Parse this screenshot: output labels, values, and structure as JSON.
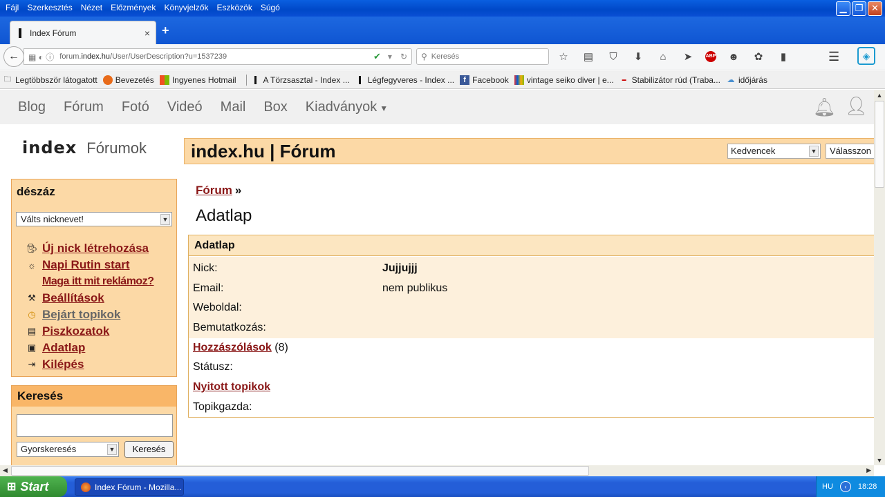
{
  "menubar": [
    "Fájl",
    "Szerkesztés",
    "Nézet",
    "Előzmények",
    "Könyvjelzők",
    "Eszközök",
    "Súgó"
  ],
  "tab": {
    "title": "Index Fórum",
    "close": "×",
    "new": "+"
  },
  "nav": {
    "url_prefix": "forum.",
    "url_domain": "index.hu",
    "url_path": "/User/UserDescription?u=1537239",
    "search_placeholder": "Keresés"
  },
  "bookmarks": [
    "Legtöbbször látogatott",
    "Bevezetés",
    "Ingyenes Hotmail",
    "A Törzsasztal - Index ...",
    "Légfegyveres - Index ...",
    "Facebook",
    "vintage seiko diver | e...",
    "Stabilizátor rúd (Traba...",
    "időjárás"
  ],
  "topnav": [
    "Blog",
    "Fórum",
    "Fotó",
    "Videó",
    "Mail",
    "Box",
    "Kiadványok"
  ],
  "logo": {
    "brand": "index",
    "section": "Fórumok"
  },
  "header": {
    "title": "index.hu | Fórum",
    "favorites": "Kedvencek",
    "choose": "Válasszon"
  },
  "sidebar": {
    "nick": "dészáz",
    "nick_select": "Válts nicknevet!",
    "links": [
      {
        "label": "Új nick létrehozása",
        "icon": "agent-icon"
      },
      {
        "label": "Napi Rutin start",
        "icon": "sun-icon"
      },
      {
        "label": "Maga itt mit reklámoz?",
        "icon": ""
      },
      {
        "label": "Beállítások",
        "icon": "tools-icon"
      },
      {
        "label": "Bejárt topikok",
        "icon": "clock-icon"
      },
      {
        "label": "Piszkozatok",
        "icon": "notepad-icon"
      },
      {
        "label": "Adatlap",
        "icon": "document-icon"
      },
      {
        "label": "Kilépés",
        "icon": "logout-icon"
      }
    ],
    "search": {
      "title": "Keresés",
      "mode": "Gyorskeresés",
      "button": "Keresés"
    }
  },
  "main": {
    "crumb": "Fórum",
    "crumb_sep": "»",
    "title": "Adatlap",
    "table_header": "Adatlap",
    "rows": {
      "nick_label": "Nick:",
      "nick_value": "Jujjujjj",
      "email_label": "Email:",
      "email_value": "nem publikus",
      "web_label": "Weboldal:",
      "intro_label": "Bemutatkozás:",
      "posts_link": "Hozzászólások",
      "posts_count": "(8)",
      "status_label": "Státusz:",
      "topics_link": "Nyitott topikok",
      "host_label": "Topikgazda:"
    }
  },
  "taskbar": {
    "start": "Start",
    "item": "Index Fórum - Mozilla...",
    "lang": "HU",
    "time": "18:28"
  }
}
